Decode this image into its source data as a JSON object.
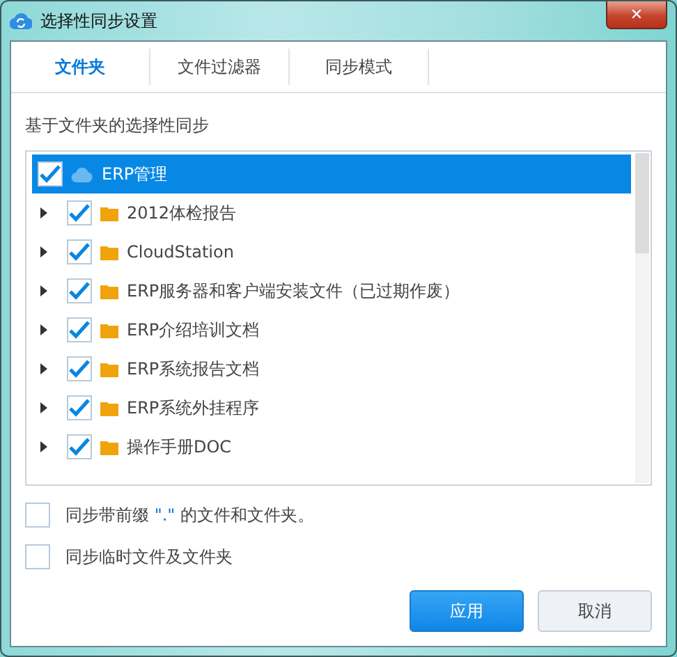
{
  "window": {
    "title": "选择性同步设置",
    "close": "✕"
  },
  "tabs": [
    {
      "label": "文件夹",
      "selected": true
    },
    {
      "label": "文件过滤器",
      "selected": false
    },
    {
      "label": "同步模式",
      "selected": false
    }
  ],
  "section_label": "基于文件夹的选择性同步",
  "tree": [
    {
      "label": "ERP管理",
      "kind": "cloud",
      "checked": true,
      "selected": true,
      "children": [
        {
          "label": "2012体检报告",
          "kind": "folder",
          "checked": true,
          "selected": false,
          "expanded": false
        },
        {
          "label": "CloudStation",
          "kind": "folder",
          "checked": true,
          "selected": false,
          "expanded": false
        },
        {
          "label": "ERP服务器和客户端安装文件（已过期作废）",
          "kind": "folder",
          "checked": true,
          "selected": false,
          "expanded": false
        },
        {
          "label": "ERP介绍培训文档",
          "kind": "folder",
          "checked": true,
          "selected": false,
          "expanded": false
        },
        {
          "label": "ERP系统报告文档",
          "kind": "folder",
          "checked": true,
          "selected": false,
          "expanded": false
        },
        {
          "label": "ERP系统外挂程序",
          "kind": "folder",
          "checked": true,
          "selected": false,
          "expanded": false
        },
        {
          "label": "操作手册DOC",
          "kind": "folder",
          "checked": true,
          "selected": false,
          "expanded": false
        }
      ]
    }
  ],
  "options": [
    {
      "parts": [
        {
          "text": "同步带前缀 ",
          "kind": "plain"
        },
        {
          "text": "\".\"",
          "kind": "highlight"
        },
        {
          "text": " 的文件和文件夹。",
          "kind": "plain"
        }
      ],
      "checked": false
    },
    {
      "parts": [
        {
          "text": "同步临时文件及文件夹",
          "kind": "plain"
        }
      ],
      "checked": false
    }
  ],
  "buttons": [
    {
      "label": "应用",
      "kind": "primary"
    },
    {
      "label": "取消",
      "kind": "secondary"
    }
  ]
}
